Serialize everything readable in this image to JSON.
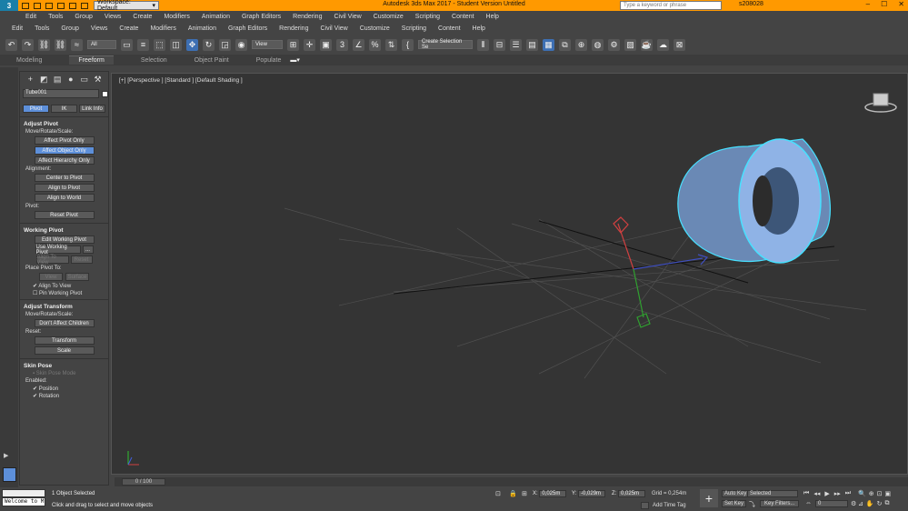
{
  "titlebar": {
    "logo": "3",
    "workspace": "Workspace: Default",
    "title": "Autodesk 3ds Max 2017 - Student Version    Untitled",
    "search_placeholder": "Type a keyword or phrase",
    "user": "s208028",
    "min": "–",
    "max": "☐",
    "close": "✕"
  },
  "menu1": [
    "Edit",
    "Tools",
    "Group",
    "Views",
    "Create",
    "Modifiers",
    "Animation",
    "Graph Editors",
    "Rendering",
    "Civil View",
    "Customize",
    "Scripting",
    "Content",
    "Help"
  ],
  "menu2": [
    "Edit",
    "Tools",
    "Group",
    "Views",
    "Create",
    "Modifiers",
    "Animation",
    "Graph Editors",
    "Rendering",
    "Civil View",
    "Customize",
    "Scripting",
    "Content",
    "Help"
  ],
  "toolbar": {
    "filter": "All",
    "refcoord": "View",
    "selection_set": "Create Selection Se"
  },
  "ribbon": {
    "tabs": [
      "Modeling",
      "Freeform",
      "Selection",
      "Object Paint",
      "Populate"
    ],
    "active": 1
  },
  "cmdpanel": {
    "object_name": "Tube001",
    "tabs": [
      "Pivot",
      "IK",
      "Link Info"
    ],
    "adjust_pivot": {
      "title": "Adjust Pivot",
      "mrs_label": "Move/Rotate/Scale:",
      "affect_pivot": "Affect Pivot Only",
      "affect_object": "Affect Object Only",
      "affect_hierarchy": "Affect Hierarchy Only",
      "alignment_label": "Alignment:",
      "center_to_pivot": "Center to Pivot",
      "align_to_pivot": "Align to Pivot",
      "align_to_world": "Align to World",
      "pivot_label": "Pivot:",
      "reset_pivot": "Reset Pivot"
    },
    "working_pivot": {
      "title": "Working Pivot",
      "edit": "Edit Working Pivot",
      "use": "Use Working Pivot",
      "ellipsis": "...",
      "align_to_view": "Align To View",
      "reset": "Reset",
      "place_label": "Place Pivot To:",
      "view": "View",
      "surface": "Surface",
      "align_to_view_chk": "Align To View",
      "pin": "Pin Working Pivot"
    },
    "adjust_transform": {
      "title": "Adjust Transform",
      "mrs_label": "Move/Rotate/Scale:",
      "dont_affect": "Don't Affect Children",
      "reset_label": "Reset:",
      "transform": "Transform",
      "scale": "Scale"
    },
    "skin_pose": {
      "title": "Skin Pose",
      "mode": "Skin Pose Mode",
      "enabled_label": "Enabled:",
      "position": "Position",
      "rotation": "Rotation"
    }
  },
  "viewport": {
    "label": "[+] [Perspective ] [Standard ] [Default Shading ]"
  },
  "timeline": {
    "slider": "0 / 100"
  },
  "status": {
    "maxscript": "Welcome to M",
    "selection": "1 Object Selected",
    "prompt": "Click and drag to select and move objects",
    "x_label": "X:",
    "x_value": "0,025m",
    "y_label": "Y:",
    "y_value": "-0,029m",
    "z_label": "Z:",
    "z_value": "0,025m",
    "grid": "Grid = 0,254m",
    "add_time_tag": "Add Time Tag",
    "auto_key": "Auto Key",
    "set_key": "Set Key",
    "selected": "Selected",
    "key_filters": "Key Filters...",
    "frame": "0"
  }
}
